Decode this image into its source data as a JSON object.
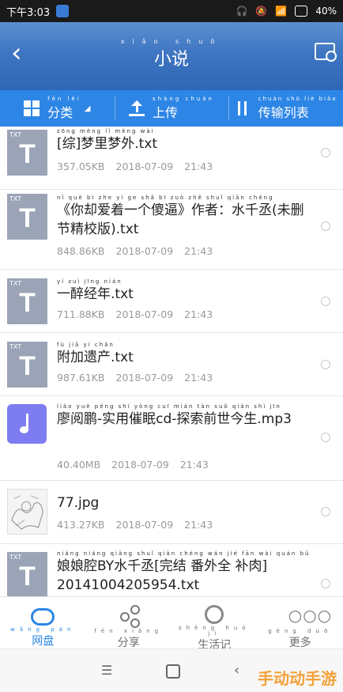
{
  "status_bar": {
    "time": "下午3:03",
    "battery": "40%"
  },
  "header": {
    "title": "小说",
    "title_pinyin": "xiǎo shuō"
  },
  "toolbar": [
    {
      "label": "分类",
      "pinyin": "fēn lèi"
    },
    {
      "label": "上传",
      "pinyin": "shàng chuán"
    },
    {
      "label": "传输列表",
      "pinyin": "chuán shū liè biǎo"
    }
  ],
  "files": [
    {
      "type": "txt",
      "badge": "TXT",
      "glyph": "T",
      "pinyin": "zōng mèng lǐ mèng wài",
      "name": "[综]梦里梦外.txt",
      "size": "357.05KB",
      "date": "2018-07-09",
      "time": "21:43"
    },
    {
      "type": "txt",
      "badge": "TXT",
      "glyph": "T",
      "pinyin": "nǐ què bì zhe yí ge shǎ bī zuò zhě shuǐ qiān chéng",
      "name": "《你却爱着一个傻逼》作者：水千丞(未删节精校版).txt",
      "size": "848.86KB",
      "date": "2018-07-09",
      "time": "21:43"
    },
    {
      "type": "txt",
      "badge": "TXT",
      "glyph": "T",
      "pinyin": "yí zuì jīng nián",
      "name": "一醉经年.txt",
      "size": "711.88KB",
      "date": "2018-07-09",
      "time": "21:43"
    },
    {
      "type": "txt",
      "badge": "TXT",
      "glyph": "T",
      "pinyin": "fù jiā yí chǎn",
      "name": "附加遗产.txt",
      "size": "987.61KB",
      "date": "2018-07-09",
      "time": "21:43"
    },
    {
      "type": "mp3",
      "pinyin": "liào yuè péng shí yòng cuī mián tàn suǒ qián shì jīn",
      "name": "廖阅鹏-实用催眠cd-探索前世今生.mp3",
      "size": "40.40MB",
      "date": "2018-07-09",
      "time": "21:43"
    },
    {
      "type": "img",
      "pinyin": "",
      "name": "77.jpg",
      "size": "413.27KB",
      "date": "2018-07-09",
      "time": "21:43"
    },
    {
      "type": "txt",
      "badge": "TXT",
      "glyph": "T",
      "pinyin": "niáng niáng qiāng shuǐ qiān chéng wán jié fān wài quán bǔ",
      "name": "娘娘腔BY水千丞[完结 番外全 补肉] 20141004205954.txt",
      "size": "",
      "date": "",
      "time": ""
    }
  ],
  "bottom_nav": [
    {
      "label": "网盘",
      "pinyin": "wǎng pán",
      "active": true
    },
    {
      "label": "分享",
      "pinyin": "fēn xiǎng",
      "active": false
    },
    {
      "label": "生活记",
      "pinyin": "shēng huó jì",
      "active": false
    },
    {
      "label": "更多",
      "pinyin": "gèng duō",
      "active": false
    }
  ],
  "watermark": "手动动手游",
  "colors": {
    "accent": "#2d86e6",
    "header": "#3f76c2",
    "mp3": "#7d7cf0",
    "txt_icon": "#9aa4b6"
  }
}
